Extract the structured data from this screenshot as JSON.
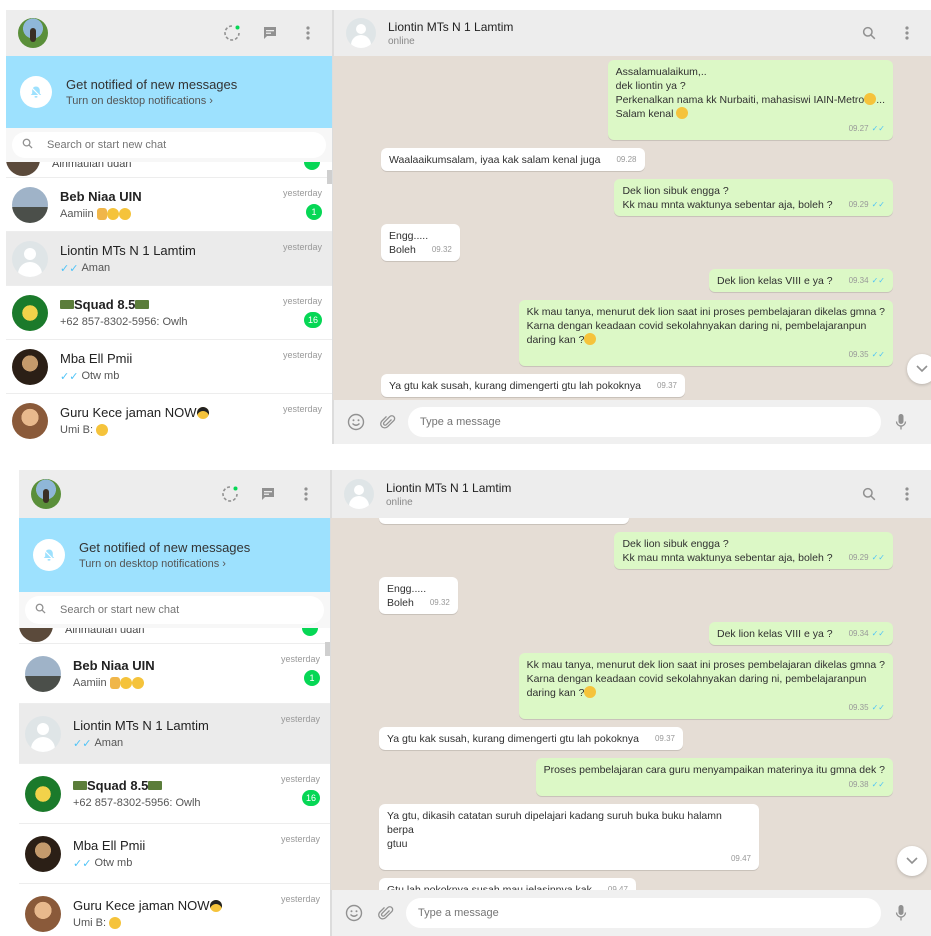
{
  "notify": {
    "title": "Get notified of new messages",
    "subtitle": "Turn on desktop notifications ›"
  },
  "search": {
    "placeholder": "Search or start new chat"
  },
  "partial_chat": {
    "text": "Ainmaulan udan"
  },
  "chats": [
    {
      "name": "Beb Niaa UIN",
      "last": "Aamiin",
      "time": "yesterday",
      "unread": "1"
    },
    {
      "name": "Liontin MTs N 1 Lamtim",
      "last": "Aman",
      "time": "yesterday",
      "unread": ""
    },
    {
      "name": "Squad 8.5",
      "last": "+62 857-8302-5956: Owlh",
      "time": "yesterday",
      "unread": "16"
    },
    {
      "name": "Mba Ell Pmii",
      "last": "Otw mb",
      "time": "yesterday",
      "unread": ""
    },
    {
      "name": "Guru Kece jaman NOW",
      "last": "Umi B:",
      "time": "yesterday",
      "unread": ""
    }
  ],
  "conversation": {
    "title": "Liontin MTs N 1 Lamtim",
    "status": "online"
  },
  "composer": {
    "placeholder": "Type a message"
  },
  "messages": [
    {
      "dir": "out",
      "text": "Assalamualaikum,..\ndek liontin ya ?\nPerkenalkan nama kk Nurbaiti, mahasiswi IAIN-Metro",
      "text2": "Salam kenal",
      "time": "09.27"
    },
    {
      "dir": "in",
      "text": "Waalaaikumsalam, iyaa kak salam kenal juga",
      "time": "09.28"
    },
    {
      "dir": "out",
      "text": "Dek lion sibuk engga ?\nKk mau mnta waktunya sebentar aja, boleh ?",
      "time": "09.29"
    },
    {
      "dir": "in",
      "text": "Engg.....\nBoleh",
      "time": "09.32"
    },
    {
      "dir": "out",
      "text": "Dek lion kelas VIII e ya ?",
      "time": "09.34"
    },
    {
      "dir": "out",
      "text": "Kk mau tanya, menurut dek lion saat ini proses pembelajaran dikelas gmna ?\nKarna dengan keadaan covid sekolahnyakan daring ni, pembelajaranpun\ndaring kan ?",
      "time": "09.35"
    },
    {
      "dir": "in",
      "text": "Ya gtu kak susah, kurang dimengerti gtu lah pokoknya",
      "time": "09.37"
    },
    {
      "dir": "out",
      "text": "Proses pembelajaran cara guru menyampaikan materinya itu gmna dek ?",
      "time": "09.38"
    },
    {
      "dir": "in",
      "text": "Ya gtu, dikasih catatan suruh dipelajari kadang suruh buka buku halamn berpa\ngtuu",
      "time": "09.47"
    },
    {
      "dir": "in",
      "text": "Gtu lah pokoknya susah mau jelasinnya kak",
      "time": "09.47"
    }
  ],
  "icon_names": [
    "status-icon",
    "new-chat-icon",
    "menu-icon",
    "bell-off-icon",
    "search-icon",
    "emoji-icon",
    "attach-icon",
    "mic-icon",
    "chevron-down-icon"
  ],
  "colors": {
    "header": "#ededed",
    "notify": "#9de1fe",
    "outgoing": "#dcf8c6",
    "incoming": "#ffffff",
    "badge": "#06d755",
    "read_ticks": "#4fc3f7",
    "wallpaper": "#e5ddd5"
  }
}
